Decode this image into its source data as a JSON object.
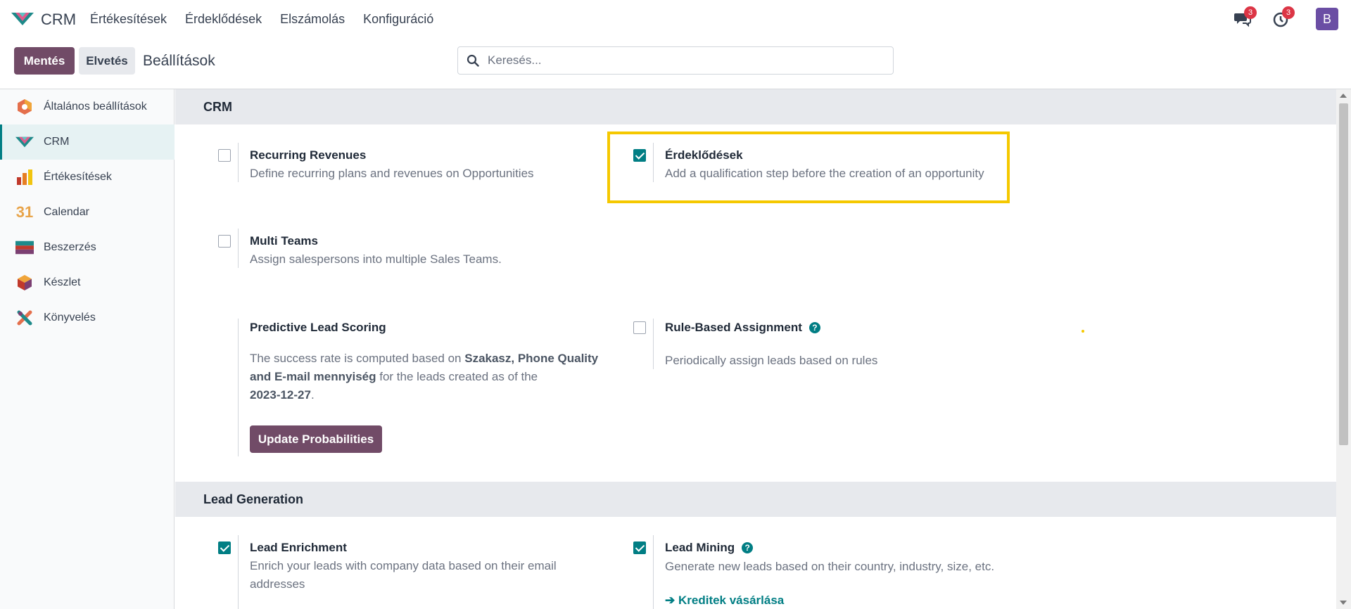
{
  "topnav": {
    "app_name": "CRM",
    "menu": [
      "Értékesítések",
      "Érdeklődések",
      "Elszámolás",
      "Konfiguráció"
    ],
    "messages_count": "3",
    "activities_count": "3",
    "avatar_letter": "B"
  },
  "control_panel": {
    "save_label": "Mentés",
    "discard_label": "Elvetés",
    "breadcrumb": "Beállítások",
    "search_placeholder": "Keresés..."
  },
  "sidebar": {
    "items": [
      {
        "label": "Általános beállítások",
        "icon": "settings-icon"
      },
      {
        "label": "CRM",
        "icon": "crm-icon",
        "active": true
      },
      {
        "label": "Értékesítések",
        "icon": "sales-icon"
      },
      {
        "label": "Calendar",
        "icon": "calendar-icon",
        "icon_text": "31"
      },
      {
        "label": "Beszerzés",
        "icon": "purchase-icon"
      },
      {
        "label": "Készlet",
        "icon": "inventory-icon"
      },
      {
        "label": "Könyvelés",
        "icon": "accounting-icon"
      }
    ]
  },
  "sections": {
    "crm": {
      "title": "CRM",
      "recurring": {
        "title": "Recurring Revenues",
        "desc": "Define recurring plans and revenues on Opportunities",
        "checked": false
      },
      "leads": {
        "title": "Érdeklődések",
        "desc": "Add a qualification step before the creation of an opportunity",
        "checked": true
      },
      "multi_teams": {
        "title": "Multi Teams",
        "desc": "Assign salespersons into multiple Sales Teams.",
        "checked": false
      },
      "pls": {
        "title": "Predictive Lead Scoring",
        "desc_1": "The success rate is computed based on ",
        "desc_bold_1": "Szakasz, Phone Quality",
        "desc_bold_2": "and E-mail mennyiség",
        "desc_2": " for the leads created as of the",
        "desc_date": "2023-12-27",
        "desc_end": ".",
        "button": "Update Probabilities"
      },
      "rule_based": {
        "title": "Rule-Based Assignment",
        "desc": "Periodically assign leads based on rules",
        "checked": false
      }
    },
    "lead_gen": {
      "title": "Lead Generation",
      "enrichment": {
        "title": "Lead Enrichment",
        "desc_1": "Enrich your leads with company data based on their email",
        "desc_2": "addresses",
        "checked": true
      },
      "mining": {
        "title": "Lead Mining",
        "desc": "Generate new leads based on their country, industry, size, etc.",
        "link": "Kreditek vásárlása",
        "checked": true
      }
    }
  },
  "colors": {
    "brand": "#714b67",
    "accent": "#017e84",
    "highlight": "#f5c800",
    "badge": "#dc3545"
  }
}
